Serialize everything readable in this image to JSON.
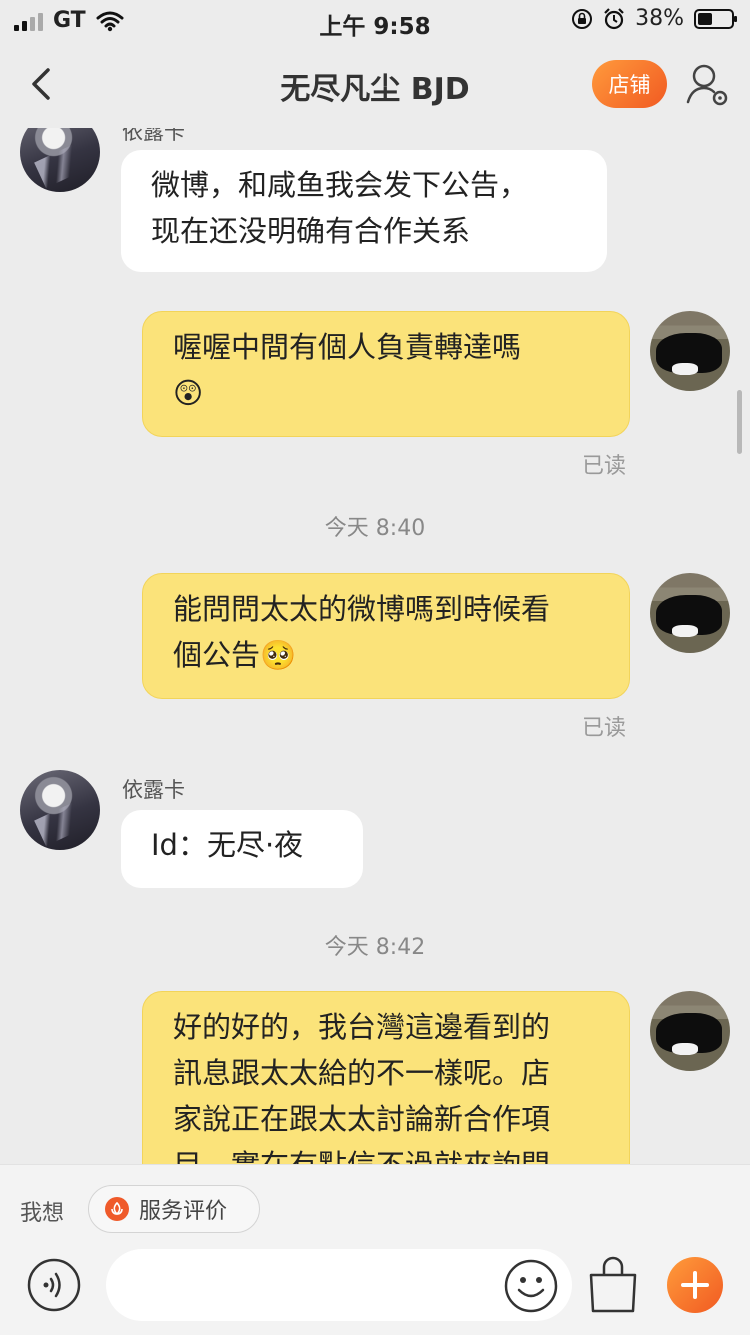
{
  "status_bar": {
    "carrier": "GT",
    "time": "上午 9:58",
    "battery": "38%"
  },
  "header": {
    "title": "无尽凡尘 BJD",
    "shop_button": "店铺",
    "user_icon": "user-settings-icon"
  },
  "messages": [
    {
      "side": "left",
      "sender": "依露卡",
      "lines": [
        "微博，和咸鱼我会发下公告，",
        "现在还没明确有合作关系"
      ]
    },
    {
      "side": "right",
      "lines": [
        "喔喔中間有個人負責轉達嗎",
        "😲"
      ],
      "status": "已读"
    },
    {
      "type": "time",
      "text": "今天 8:40"
    },
    {
      "side": "right",
      "lines": [
        "能問問太太的微博嗎到時候看",
        "個公告🥺"
      ],
      "status": "已读"
    },
    {
      "side": "left",
      "sender": "依露卡",
      "lines": [
        "Id：无尽·夜"
      ]
    },
    {
      "type": "time",
      "text": "今天 8:42"
    },
    {
      "side": "right",
      "lines": [
        "好的好的，我台灣這邊看到的",
        "訊息跟太太給的不一樣呢。店",
        "家說正在跟太太討論新合作項",
        "目，實在有點信不過就來詢問"
      ]
    }
  ],
  "bottom_bar": {
    "wish_label": "我想",
    "service_button": "服务评价",
    "icons": [
      "voice-icon",
      "emoji-icon",
      "shopping-bag-icon",
      "plus-icon"
    ]
  },
  "colors": {
    "accent": "#f15a22",
    "sent_bubble": "#fbe37a",
    "received_bubble": "#ffffff"
  }
}
